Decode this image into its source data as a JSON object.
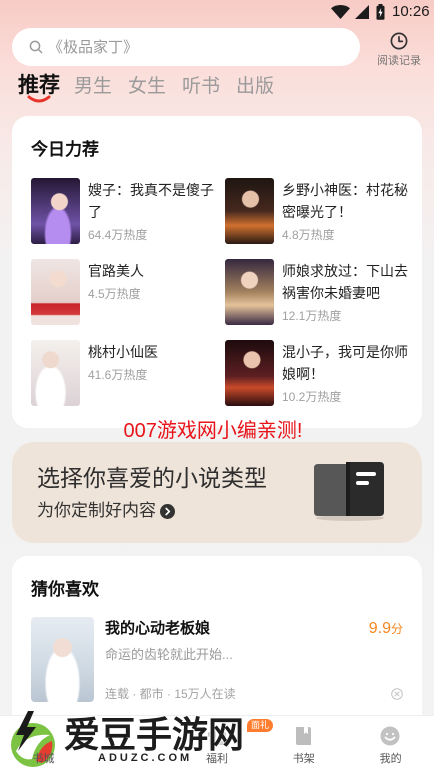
{
  "status_bar": {
    "time": "10:26",
    "icons": [
      "wifi-icon",
      "signal-icon",
      "battery-icon"
    ]
  },
  "search": {
    "placeholder": "《极品家丁》",
    "icon": "search-icon"
  },
  "history": {
    "label": "阅读记录",
    "icon": "clock-icon"
  },
  "tabs": [
    {
      "label": "推荐",
      "active": true
    },
    {
      "label": "男生",
      "active": false
    },
    {
      "label": "女生",
      "active": false
    },
    {
      "label": "听书",
      "active": false
    },
    {
      "label": "出版",
      "active": false
    }
  ],
  "today_pick": {
    "title": "今日力荐",
    "books": [
      {
        "title": "嫂子：我真不是傻子了",
        "heat": "64.4万热度"
      },
      {
        "title": "乡野小神医：村花秘密曝光了！",
        "heat": "4.8万热度"
      },
      {
        "title": "官路美人",
        "heat": "4.5万热度"
      },
      {
        "title": "师娘求放过：下山去祸害你未婚妻吧",
        "heat": "12.1万热度"
      },
      {
        "title": "桃村小仙医",
        "heat": "41.6万热度"
      },
      {
        "title": "混小子，我可是你师娘啊！",
        "heat": "10.2万热度"
      }
    ]
  },
  "promo_note": "007游戏网小编亲测!",
  "banner": {
    "title": "选择你喜爱的小说类型",
    "subtitle": "为你定制好内容",
    "icon": "open-book-icon"
  },
  "guess": {
    "title": "猜你喜欢",
    "items": [
      {
        "title": "我的心动老板娘",
        "score": "9.9",
        "score_unit": "分",
        "desc": "命运的齿轮就此开始...",
        "meta": "连载 · 都市 · 15万人在读"
      }
    ]
  },
  "bottom_nav": {
    "items": [
      {
        "label": "书城",
        "icon": "bookstore-icon"
      },
      {
        "label": "福利",
        "icon": "gift-icon",
        "badge": "面礼"
      },
      {
        "label": "书架",
        "icon": "bookshelf-icon"
      },
      {
        "label": "我的",
        "icon": "profile-icon"
      }
    ]
  },
  "watermark": {
    "name": "爱豆手游网",
    "domain": "ADUZC.COM"
  },
  "colors": {
    "tab_accent": "#e8332a",
    "score": "#f5861f",
    "promo_text": "#e8141a",
    "badge": "#ff7d2e",
    "banner_bg": "#efe4d9"
  }
}
